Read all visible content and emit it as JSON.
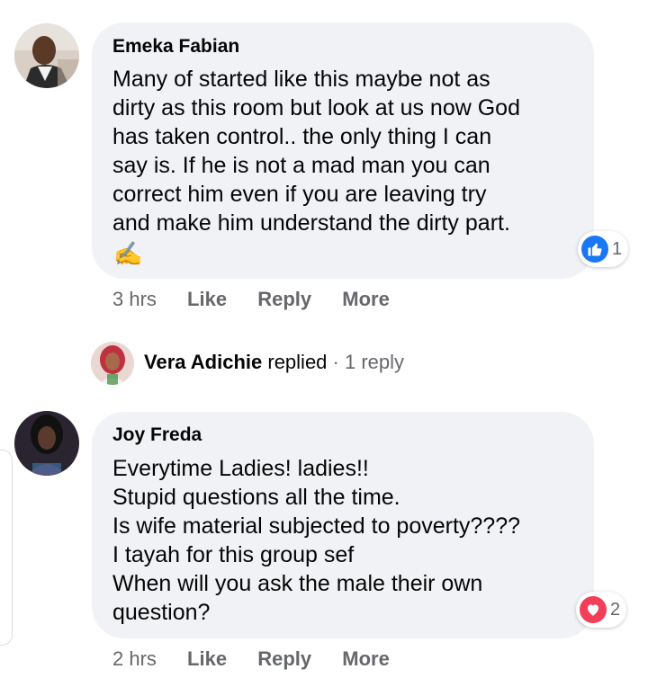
{
  "comments": [
    {
      "author": "Emeka Fabian",
      "lines": [
        "Many of started like this maybe not as",
        "dirty as this room but look at us now God",
        "has taken control.. the only thing I can",
        "say is. If he is not a mad man you can",
        "correct him even if you are leaving try",
        "and make him understand the dirty part."
      ],
      "emoji": "✍️",
      "time": "3 hrs",
      "like": "Like",
      "reply": "Reply",
      "more": "More",
      "reaction": {
        "icon": "like-icon",
        "color": "#1877f2",
        "count": "1"
      }
    },
    {
      "author": "Joy Freda",
      "lines": [
        "Everytime Ladies! ladies!!",
        "Stupid questions all the time.",
        "Is wife material subjected to poverty????",
        "I tayah for this group sef",
        "When will you ask the male their own",
        "question?"
      ],
      "time": "2 hrs",
      "like": "Like",
      "reply": "Reply",
      "more": "More",
      "reaction": {
        "icon": "love-icon",
        "color": "#f33e58",
        "count": "2"
      }
    }
  ],
  "reply_summary": {
    "name": "Vera Adichie",
    "verb": "replied",
    "separator": "·",
    "count": "1 reply"
  },
  "colors": {
    "bubble": "#f0f2f5",
    "secondary_text": "#65676b",
    "like_blue": "#1877f2",
    "love_red": "#f33e58"
  }
}
